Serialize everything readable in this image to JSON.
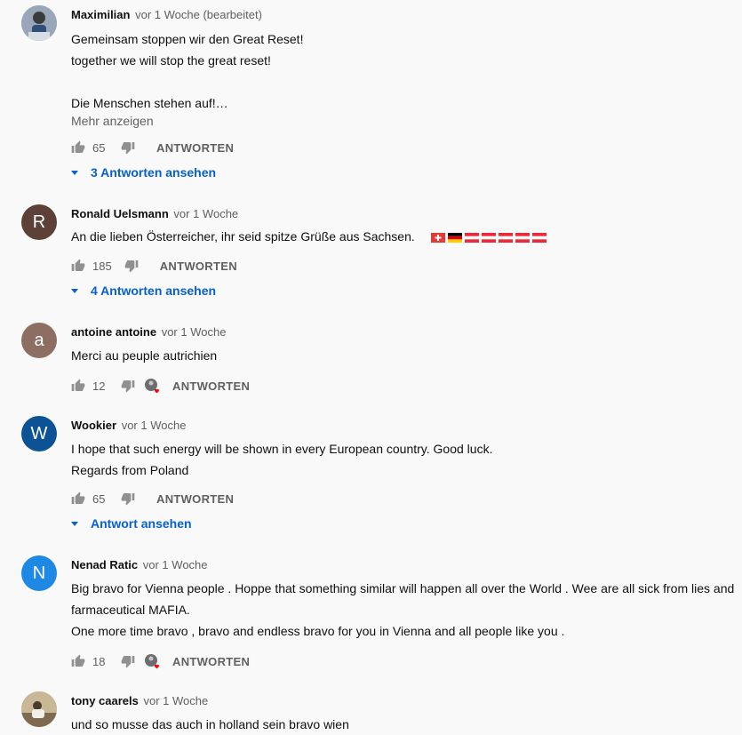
{
  "comments": [
    {
      "author": "Maximilian",
      "meta": "vor 1 Woche (bearbeitet)",
      "lines": [
        "Gemeinsam stoppen wir den Great Reset!",
        "together we will stop the great reset!",
        "",
        "Die Menschen stehen auf!…"
      ],
      "more": "Mehr anzeigen",
      "likes": "65",
      "reply": "ANTWORTEN",
      "replies": "3 Antworten ansehen"
    },
    {
      "author": "Ronald Uelsmann",
      "meta": "vor 1 Woche",
      "avatar_letter": "R",
      "avatar_color": "#5d4037",
      "lines": [
        "An die lieben Österreicher, ihr seid spitze Grüße aus Sachsen."
      ],
      "flags": [
        "swiss-flag-icon",
        "german-flag-icon",
        "austrian-flag-icon",
        "austrian-flag-icon",
        "austrian-flag-icon",
        "austrian-flag-icon",
        "austrian-flag-icon"
      ],
      "likes": "185",
      "reply": "ANTWORTEN",
      "replies": "4 Antworten ansehen"
    },
    {
      "author": "antoine antoine",
      "meta": "vor 1 Woche",
      "avatar_letter": "a",
      "avatar_color": "#8d6e63",
      "lines": [
        "Merci au peuple autrichien"
      ],
      "likes": "12",
      "reply": "ANTWORTEN"
    },
    {
      "author": "Wookier",
      "meta": "vor 1 Woche",
      "avatar_letter": "W",
      "avatar_color": "#0b5394",
      "lines": [
        "I hope that such energy will be shown in every European country. Good luck.",
        "Regards from Poland"
      ],
      "likes": "65",
      "reply": "ANTWORTEN",
      "replies": "Antwort ansehen"
    },
    {
      "author": "Nenad Ratic",
      "meta": "vor 1 Woche",
      "avatar_letter": "N",
      "avatar_color": "#1e88e5",
      "lines": [
        "Big bravo for Vienna people . Hoppe that something similar will happen all over the World . Wee are all sick from lies and",
        "farmaceutical MAFIA.",
        "One more time bravo , bravo and endless bravo for you in Vienna and all people like you ."
      ],
      "likes": "18",
      "reply": "ANTWORTEN"
    },
    {
      "author": "tony caarels",
      "meta": "vor 1 Woche",
      "lines": [
        "und so musse das auch in holland sein bravo wien"
      ]
    }
  ],
  "icons": {
    "like": "thumb-up-icon",
    "dislike": "thumb-down-icon",
    "heart": "creator-heart-icon",
    "expand": "caret-down-icon"
  },
  "colors": {
    "link": "#065fd4",
    "heart": "#ff0000",
    "muted": "#606060"
  }
}
